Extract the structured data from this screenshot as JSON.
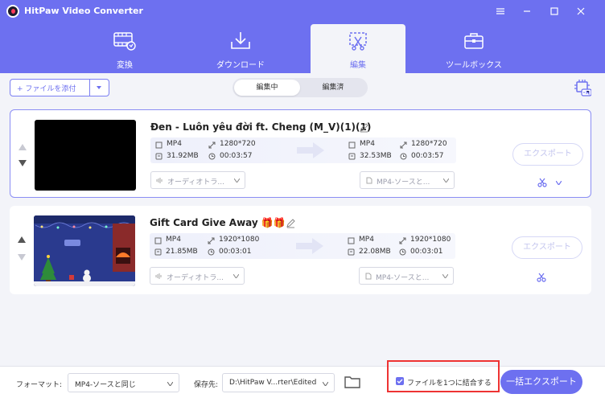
{
  "app": {
    "title": "HitPaw Video Converter"
  },
  "tabs": [
    {
      "label": "変換",
      "icon": "film-convert-icon"
    },
    {
      "label": "ダウンロード",
      "icon": "download-tray-icon"
    },
    {
      "label": "編集",
      "icon": "edit-crop-icon",
      "active": true
    },
    {
      "label": "ツールボックス",
      "icon": "toolbox-icon"
    }
  ],
  "toolbar": {
    "add_file_label": "+ ファイルを添付",
    "segments": [
      {
        "label": "編集中",
        "active": true
      },
      {
        "label": "編集済",
        "active": false
      }
    ]
  },
  "files": [
    {
      "title": "Đen - Luôn yêu đời ft. Cheng (M_V)(1)(1)",
      "source": {
        "format": "MP4",
        "resolution": "1280*720",
        "size": "31.92MB",
        "duration": "00:03:57"
      },
      "output": {
        "format": "MP4",
        "resolution": "1280*720",
        "size": "32.53MB",
        "duration": "00:03:57"
      },
      "audio_dropdown": "オーディオトラ...",
      "format_dropdown": "MP4-ソースと...",
      "export_label": "エクスポート",
      "selected": true
    },
    {
      "title": "Gift Card Give Away 🎁🎁",
      "source": {
        "format": "MP4",
        "resolution": "1920*1080",
        "size": "21.85MB",
        "duration": "00:03:01"
      },
      "output": {
        "format": "MP4",
        "resolution": "1920*1080",
        "size": "22.08MB",
        "duration": "00:03:01"
      },
      "audio_dropdown": "オーディオトラ...",
      "format_dropdown": "MP4-ソースと...",
      "export_label": "エクスポート",
      "selected": false
    }
  ],
  "footer": {
    "format_label": "フォーマット:",
    "format_value": "MP4-ソースと同じ",
    "save_label": "保存先:",
    "save_value": "D:\\HitPaw V...rter\\Edited",
    "merge_label": "ファイルを1つに結合する",
    "merge_checked": true,
    "batch_export_label": "一括エクスポート"
  },
  "colors": {
    "accent": "#6d70f0",
    "highlight": "#ee3333"
  }
}
